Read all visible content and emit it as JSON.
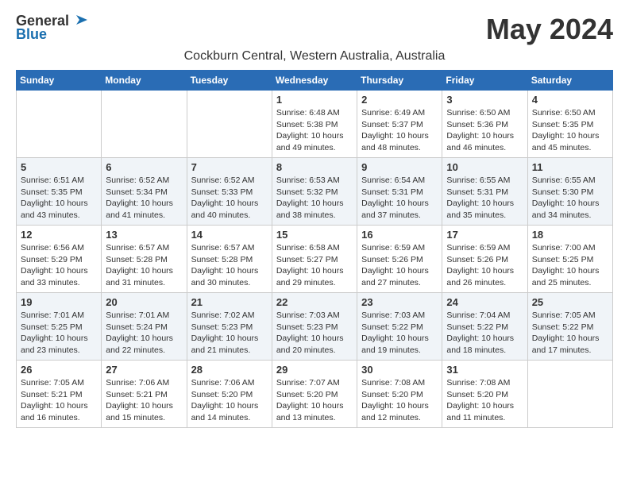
{
  "logo": {
    "general": "General",
    "blue": "Blue"
  },
  "title": "May 2024",
  "location": "Cockburn Central, Western Australia, Australia",
  "days_of_week": [
    "Sunday",
    "Monday",
    "Tuesday",
    "Wednesday",
    "Thursday",
    "Friday",
    "Saturday"
  ],
  "weeks": [
    [
      {
        "day": "",
        "info": ""
      },
      {
        "day": "",
        "info": ""
      },
      {
        "day": "",
        "info": ""
      },
      {
        "day": "1",
        "info": "Sunrise: 6:48 AM\nSunset: 5:38 PM\nDaylight: 10 hours and 49 minutes."
      },
      {
        "day": "2",
        "info": "Sunrise: 6:49 AM\nSunset: 5:37 PM\nDaylight: 10 hours and 48 minutes."
      },
      {
        "day": "3",
        "info": "Sunrise: 6:50 AM\nSunset: 5:36 PM\nDaylight: 10 hours and 46 minutes."
      },
      {
        "day": "4",
        "info": "Sunrise: 6:50 AM\nSunset: 5:35 PM\nDaylight: 10 hours and 45 minutes."
      }
    ],
    [
      {
        "day": "5",
        "info": "Sunrise: 6:51 AM\nSunset: 5:35 PM\nDaylight: 10 hours and 43 minutes."
      },
      {
        "day": "6",
        "info": "Sunrise: 6:52 AM\nSunset: 5:34 PM\nDaylight: 10 hours and 41 minutes."
      },
      {
        "day": "7",
        "info": "Sunrise: 6:52 AM\nSunset: 5:33 PM\nDaylight: 10 hours and 40 minutes."
      },
      {
        "day": "8",
        "info": "Sunrise: 6:53 AM\nSunset: 5:32 PM\nDaylight: 10 hours and 38 minutes."
      },
      {
        "day": "9",
        "info": "Sunrise: 6:54 AM\nSunset: 5:31 PM\nDaylight: 10 hours and 37 minutes."
      },
      {
        "day": "10",
        "info": "Sunrise: 6:55 AM\nSunset: 5:31 PM\nDaylight: 10 hours and 35 minutes."
      },
      {
        "day": "11",
        "info": "Sunrise: 6:55 AM\nSunset: 5:30 PM\nDaylight: 10 hours and 34 minutes."
      }
    ],
    [
      {
        "day": "12",
        "info": "Sunrise: 6:56 AM\nSunset: 5:29 PM\nDaylight: 10 hours and 33 minutes."
      },
      {
        "day": "13",
        "info": "Sunrise: 6:57 AM\nSunset: 5:28 PM\nDaylight: 10 hours and 31 minutes."
      },
      {
        "day": "14",
        "info": "Sunrise: 6:57 AM\nSunset: 5:28 PM\nDaylight: 10 hours and 30 minutes."
      },
      {
        "day": "15",
        "info": "Sunrise: 6:58 AM\nSunset: 5:27 PM\nDaylight: 10 hours and 29 minutes."
      },
      {
        "day": "16",
        "info": "Sunrise: 6:59 AM\nSunset: 5:26 PM\nDaylight: 10 hours and 27 minutes."
      },
      {
        "day": "17",
        "info": "Sunrise: 6:59 AM\nSunset: 5:26 PM\nDaylight: 10 hours and 26 minutes."
      },
      {
        "day": "18",
        "info": "Sunrise: 7:00 AM\nSunset: 5:25 PM\nDaylight: 10 hours and 25 minutes."
      }
    ],
    [
      {
        "day": "19",
        "info": "Sunrise: 7:01 AM\nSunset: 5:25 PM\nDaylight: 10 hours and 23 minutes."
      },
      {
        "day": "20",
        "info": "Sunrise: 7:01 AM\nSunset: 5:24 PM\nDaylight: 10 hours and 22 minutes."
      },
      {
        "day": "21",
        "info": "Sunrise: 7:02 AM\nSunset: 5:23 PM\nDaylight: 10 hours and 21 minutes."
      },
      {
        "day": "22",
        "info": "Sunrise: 7:03 AM\nSunset: 5:23 PM\nDaylight: 10 hours and 20 minutes."
      },
      {
        "day": "23",
        "info": "Sunrise: 7:03 AM\nSunset: 5:22 PM\nDaylight: 10 hours and 19 minutes."
      },
      {
        "day": "24",
        "info": "Sunrise: 7:04 AM\nSunset: 5:22 PM\nDaylight: 10 hours and 18 minutes."
      },
      {
        "day": "25",
        "info": "Sunrise: 7:05 AM\nSunset: 5:22 PM\nDaylight: 10 hours and 17 minutes."
      }
    ],
    [
      {
        "day": "26",
        "info": "Sunrise: 7:05 AM\nSunset: 5:21 PM\nDaylight: 10 hours and 16 minutes."
      },
      {
        "day": "27",
        "info": "Sunrise: 7:06 AM\nSunset: 5:21 PM\nDaylight: 10 hours and 15 minutes."
      },
      {
        "day": "28",
        "info": "Sunrise: 7:06 AM\nSunset: 5:20 PM\nDaylight: 10 hours and 14 minutes."
      },
      {
        "day": "29",
        "info": "Sunrise: 7:07 AM\nSunset: 5:20 PM\nDaylight: 10 hours and 13 minutes."
      },
      {
        "day": "30",
        "info": "Sunrise: 7:08 AM\nSunset: 5:20 PM\nDaylight: 10 hours and 12 minutes."
      },
      {
        "day": "31",
        "info": "Sunrise: 7:08 AM\nSunset: 5:20 PM\nDaylight: 10 hours and 11 minutes."
      },
      {
        "day": "",
        "info": ""
      }
    ]
  ]
}
